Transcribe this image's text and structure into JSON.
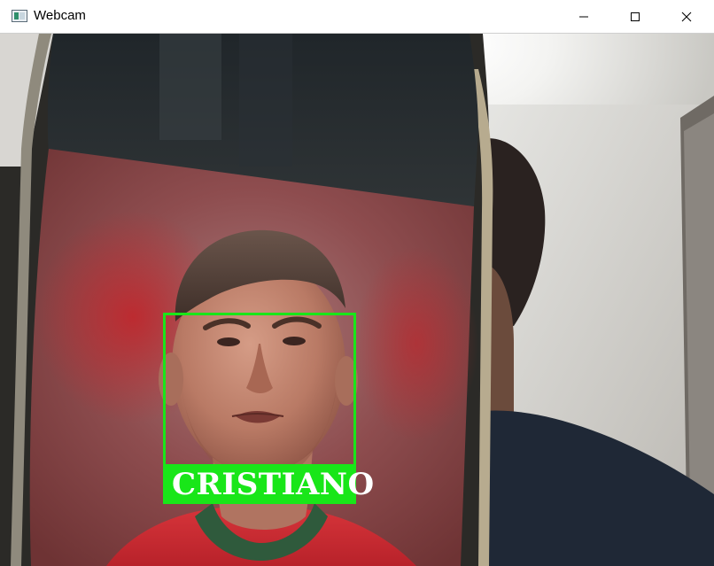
{
  "window": {
    "title": "Webcam",
    "icon": "app-window-icon",
    "controls": {
      "minimize_icon": "minimize-icon",
      "maximize_icon": "maximize-icon",
      "close_icon": "close-icon"
    }
  },
  "detection": {
    "label": "CRISTIANO",
    "box_color": "#19e619",
    "label_text_color": "#ffffff"
  }
}
